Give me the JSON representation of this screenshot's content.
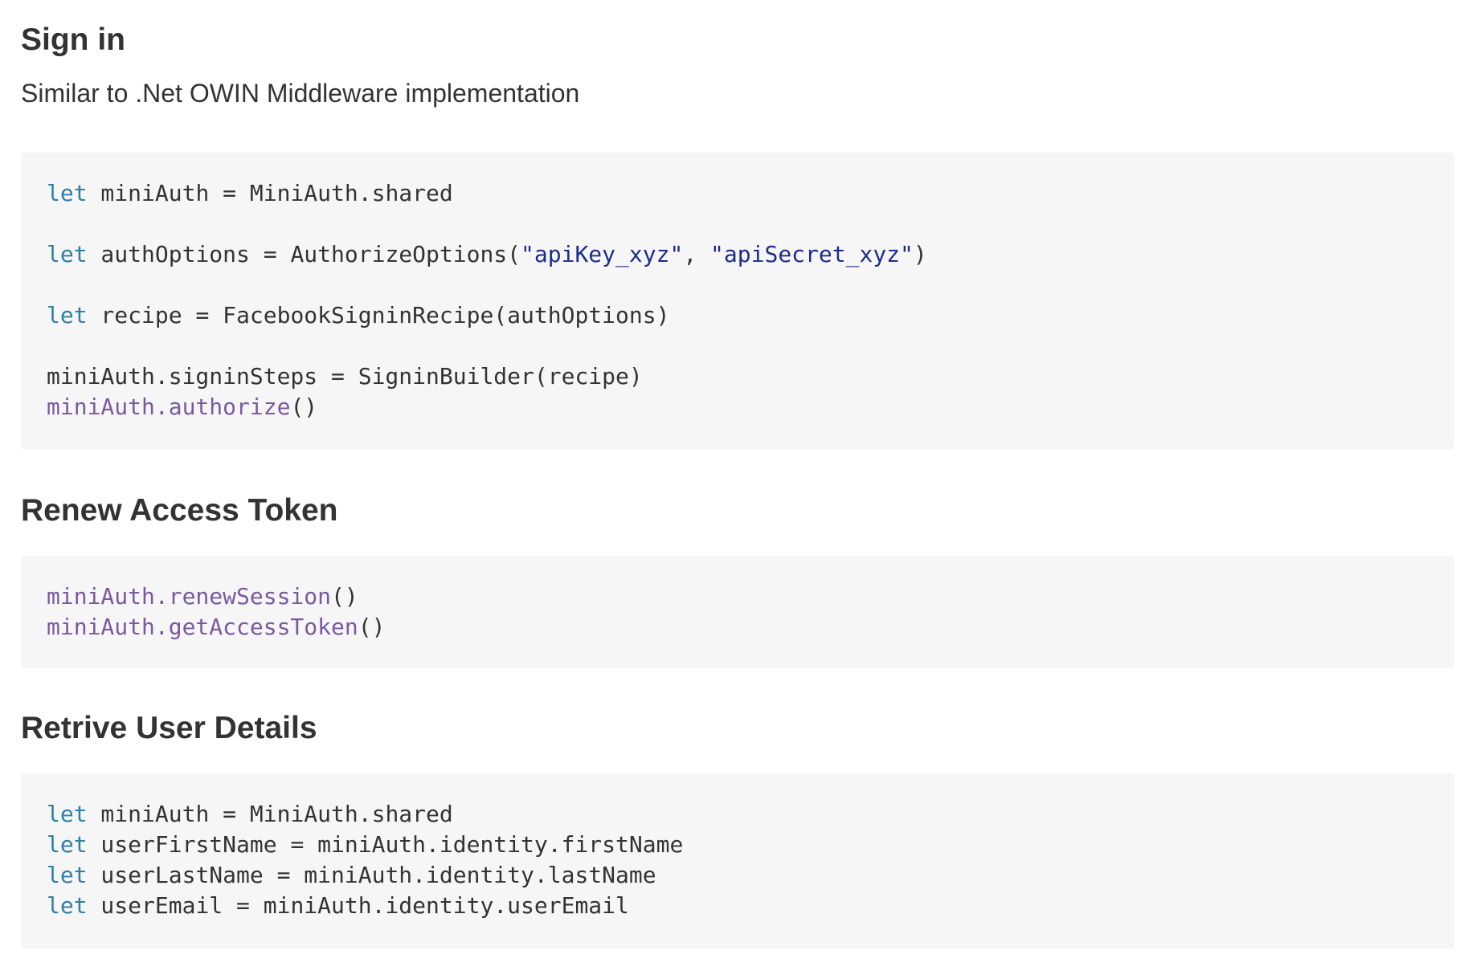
{
  "sections": [
    {
      "heading": "Sign in",
      "intro": "Similar to .Net OWIN Middleware implementation",
      "code": {
        "l1": {
          "kw": "let",
          "rest": " miniAuth = MiniAuth.shared"
        },
        "l2": {
          "kw": "let",
          "pre": " authOptions = AuthorizeOptions(",
          "s1": "\"apiKey_xyz\"",
          "mid": ", ",
          "s2": "\"apiSecret_xyz\"",
          "post": ")"
        },
        "l3": {
          "kw": "let",
          "rest": " recipe = FacebookSigninRecipe(authOptions)"
        },
        "l4": {
          "rest": "miniAuth.signinSteps = SigninBuilder(recipe)"
        },
        "l5": {
          "fn": "miniAuth.authorize",
          "post": "()"
        }
      }
    },
    {
      "heading": "Renew Access Token",
      "code": {
        "l1": {
          "fn": "miniAuth.renewSession",
          "post": "()"
        },
        "l2": {
          "fn": "miniAuth.getAccessToken",
          "post": "()"
        }
      }
    },
    {
      "heading": "Retrive User Details",
      "code": {
        "l1": {
          "kw": "let",
          "rest": " miniAuth = MiniAuth.shared"
        },
        "l2": {
          "kw": "let",
          "rest": " userFirstName = miniAuth.identity.firstName"
        },
        "l3": {
          "kw": "let",
          "rest": " userLastName = miniAuth.identity.lastName"
        },
        "l4": {
          "kw": "let",
          "rest": " userEmail = miniAuth.identity.userEmail"
        }
      }
    }
  ],
  "colors": {
    "keyword": "#2f7fa6",
    "string": "#1c2c8a",
    "function": "#7a59a0",
    "code_background": "#f6f6f6"
  }
}
